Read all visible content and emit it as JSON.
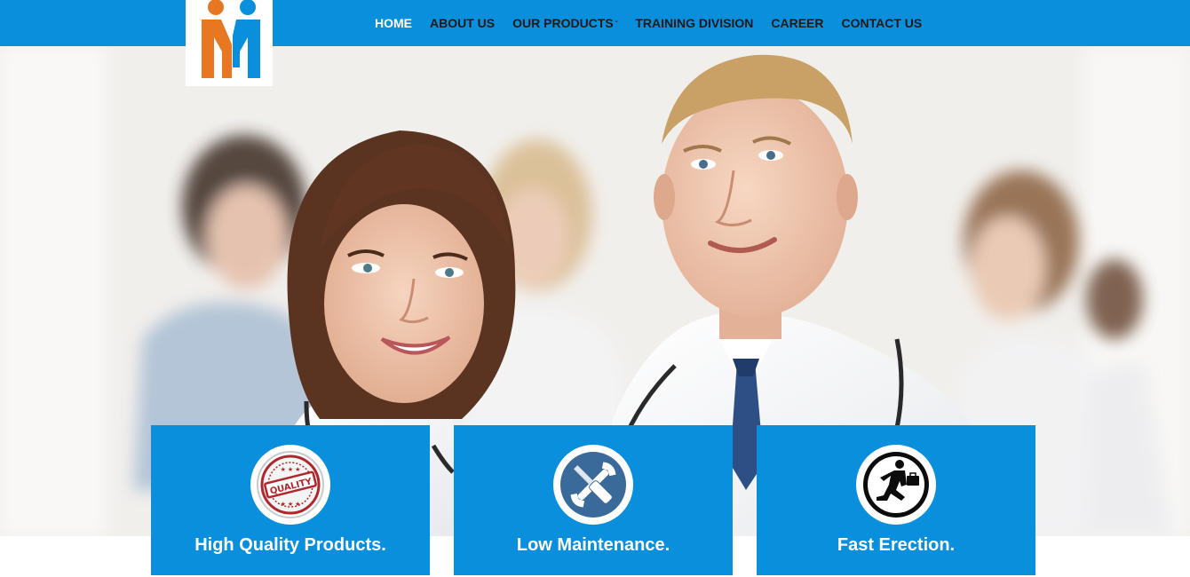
{
  "nav": {
    "items": [
      {
        "label": "HOME",
        "active": true
      },
      {
        "label": "ABOUT US",
        "active": false
      },
      {
        "label": "OUR PRODUCTS",
        "active": false,
        "has_dropdown": true
      },
      {
        "label": "TRAINING DIVISION",
        "active": false
      },
      {
        "label": "CAREER",
        "active": false
      },
      {
        "label": "CONTACT US",
        "active": false
      }
    ],
    "dropdown_caret": "ˇ"
  },
  "logo": {
    "icon": "two-people-m-logo-icon",
    "colors": {
      "left": "#e87722",
      "right": "#0a8fdc"
    }
  },
  "hero": {
    "image": "smiling-medical-staff-photo"
  },
  "features": [
    {
      "title": "High Quality Products.",
      "icon": "quality-stamp-icon",
      "stamp_text": "QUALITY"
    },
    {
      "title": "Low Maintenance.",
      "icon": "wrench-screwdriver-icon"
    },
    {
      "title": "Fast Erection.",
      "icon": "running-businessman-icon"
    }
  ],
  "colors": {
    "brand_blue": "#0a8fdc",
    "nav_text": "#1a1a1a",
    "nav_active": "#ffffff",
    "stamp_red": "#b0262c",
    "icon_dark": "#3a6a9a"
  }
}
